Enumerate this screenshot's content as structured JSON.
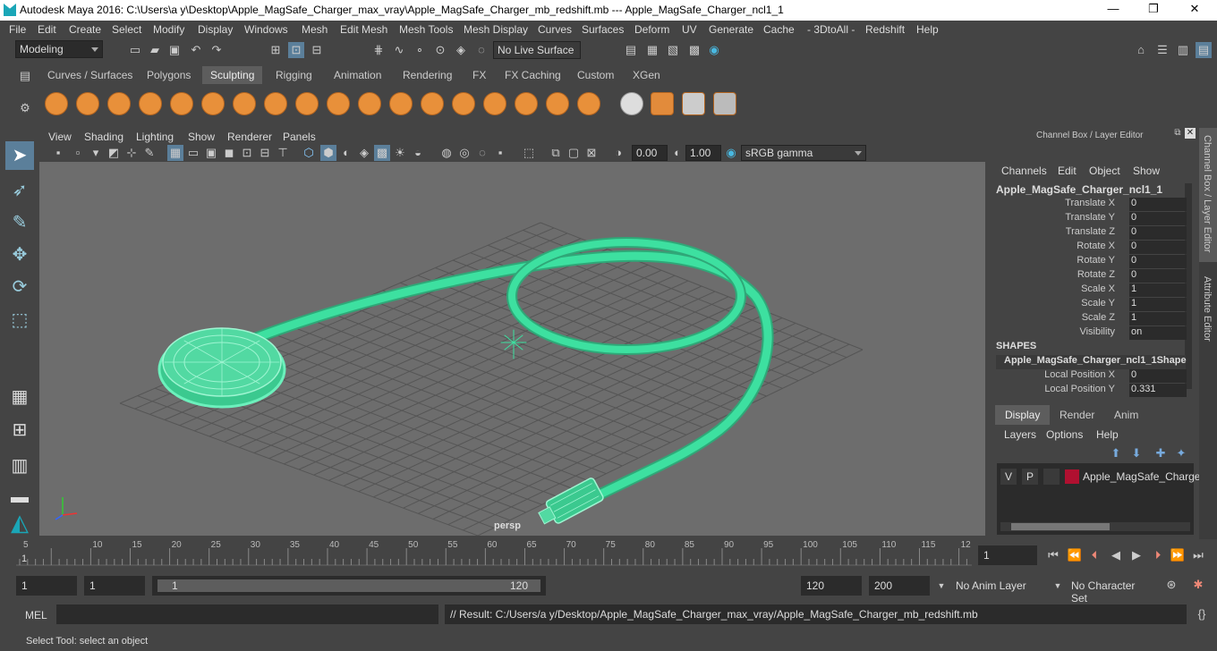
{
  "window": {
    "title": "Autodesk Maya 2016: C:\\Users\\a y\\Desktop\\Apple_MagSafe_Charger_max_vray\\Apple_MagSafe_Charger_mb_redshift.mb   ---   Apple_MagSafe_Charger_ncl1_1",
    "minimize": "—",
    "restore": "❐",
    "close": "✕"
  },
  "menubar": [
    "File",
    "Edit",
    "Create",
    "Select",
    "Modify",
    "Display",
    "Windows",
    "Mesh",
    "Edit Mesh",
    "Mesh Tools",
    "Mesh Display",
    "Curves",
    "Surfaces",
    "Deform",
    "UV",
    "Generate",
    "Cache",
    "- 3DtoAll -",
    "Redshift",
    "Help"
  ],
  "statusline": {
    "mode": "Modeling",
    "live_surface": "No Live Surface"
  },
  "shelf_tabs": [
    "Curves / Surfaces",
    "Polygons",
    "Sculpting",
    "Rigging",
    "Animation",
    "Rendering",
    "FX",
    "FX Caching",
    "Custom",
    "XGen"
  ],
  "active_shelf_tab": "Sculpting",
  "viewport": {
    "menu": [
      "View",
      "Shading",
      "Lighting",
      "Show",
      "Renderer",
      "Panels"
    ],
    "exposure": "0.00",
    "gamma": "1.00",
    "colorspace": "sRGB gamma",
    "camera": "persp"
  },
  "channel_box": {
    "header": "Channel Box / Layer Editor",
    "menu": [
      "Channels",
      "Edit",
      "Object",
      "Show"
    ],
    "object_name": "Apple_MagSafe_Charger_ncl1_1",
    "attributes": [
      {
        "label": "Translate X",
        "value": "0"
      },
      {
        "label": "Translate Y",
        "value": "0"
      },
      {
        "label": "Translate Z",
        "value": "0"
      },
      {
        "label": "Rotate X",
        "value": "0"
      },
      {
        "label": "Rotate Y",
        "value": "0"
      },
      {
        "label": "Rotate Z",
        "value": "0"
      },
      {
        "label": "Scale X",
        "value": "1"
      },
      {
        "label": "Scale Y",
        "value": "1"
      },
      {
        "label": "Scale Z",
        "value": "1"
      },
      {
        "label": "Visibility",
        "value": "on"
      }
    ],
    "shapes_label": "SHAPES",
    "shape_name": "Apple_MagSafe_Charger_ncl1_1Shape",
    "shape_attributes": [
      {
        "label": "Local Position X",
        "value": "0"
      },
      {
        "label": "Local Position Y",
        "value": "0.331"
      }
    ]
  },
  "side_tabs": [
    "Channel Box / Layer Editor",
    "Attribute Editor"
  ],
  "layer_editor": {
    "tabs": [
      "Display",
      "Render",
      "Anim"
    ],
    "active_tab": "Display",
    "menu": [
      "Layers",
      "Options",
      "Help"
    ],
    "layer": {
      "v": "V",
      "p": "P",
      "name": "Apple_MagSafe_Charger",
      "color": "#b01030"
    }
  },
  "timeline": {
    "ticks": [
      "5",
      "10",
      "15",
      "20",
      "25",
      "30",
      "35",
      "40",
      "45",
      "50",
      "55",
      "60",
      "65",
      "70",
      "75",
      "80",
      "85",
      "90",
      "95",
      "100",
      "105",
      "110",
      "115",
      "12"
    ],
    "start_marker": "1",
    "current_frame": "1"
  },
  "range": {
    "start": "1",
    "playback_start": "1",
    "slider_start": "1",
    "slider_end": "120",
    "playback_end": "120",
    "end": "200",
    "anim_layer": "No Anim Layer",
    "character_set": "No Character Set"
  },
  "command": {
    "mel_label": "MEL",
    "result": "// Result: C:/Users/a y/Desktop/Apple_MagSafe_Charger_max_vray/Apple_MagSafe_Charger_mb_redshift.mb"
  },
  "help_line": "Select Tool: select an object",
  "colors": {
    "wire": "#3de0a0",
    "viewport_bg": "#6d6d6d",
    "ui_bg": "#444444"
  }
}
